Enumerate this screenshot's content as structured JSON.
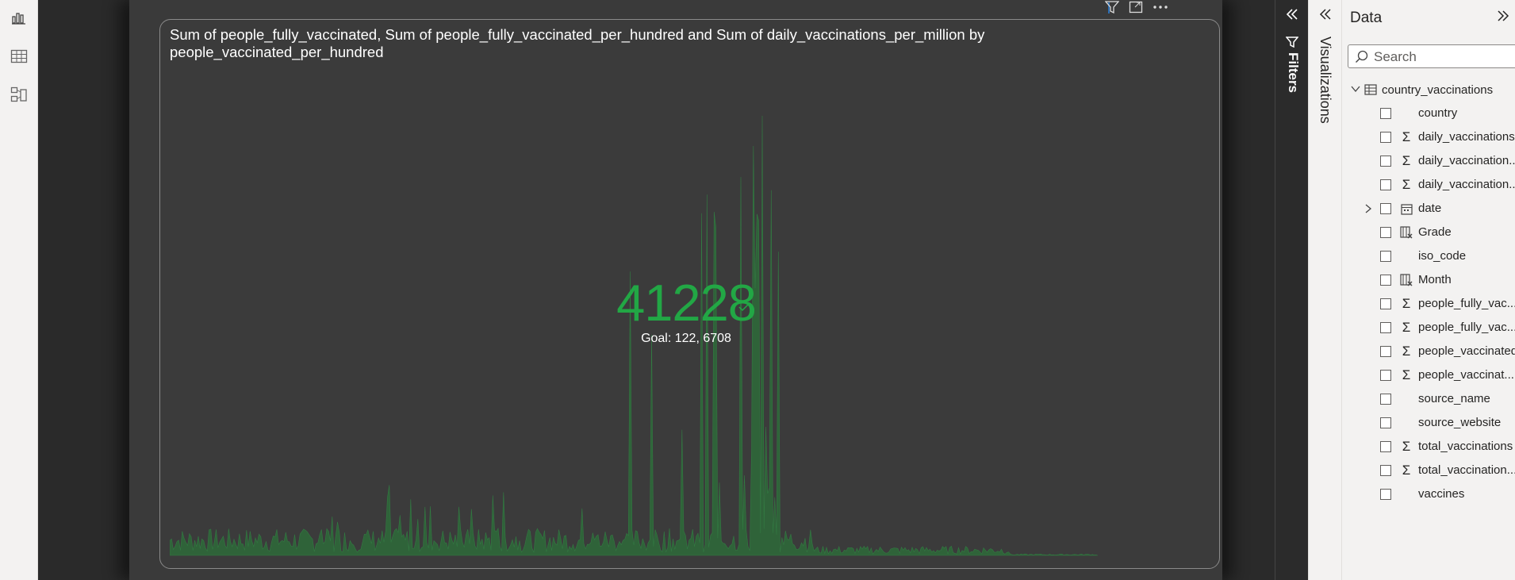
{
  "visual": {
    "title": "Sum of people_fully_vaccinated, Sum of people_fully_vaccinated_per_hundred and Sum of daily_vaccinations_per_million by people_vaccinated_per_hundred",
    "kpi_value": "41228",
    "kpi_goal": "Goal: 122, 6708",
    "accent_color": "#22a745",
    "area_color": "#2e6b3a"
  },
  "panes": {
    "filters_label": "Filters",
    "visualizations_label": "Visualizations",
    "data_title": "Data",
    "search_placeholder": "Search"
  },
  "table": {
    "name": "country_vaccinations"
  },
  "fields": [
    {
      "name": "country",
      "icon": "none"
    },
    {
      "name": "daily_vaccinations",
      "icon": "sigma"
    },
    {
      "name": "daily_vaccination...",
      "icon": "sigma"
    },
    {
      "name": "daily_vaccination...",
      "icon": "sigma"
    },
    {
      "name": "date",
      "icon": "calendar",
      "expandable": true
    },
    {
      "name": "Grade",
      "icon": "calc-column"
    },
    {
      "name": "iso_code",
      "icon": "none"
    },
    {
      "name": "Month",
      "icon": "calc-column"
    },
    {
      "name": "people_fully_vac...",
      "icon": "sigma"
    },
    {
      "name": "people_fully_vac...",
      "icon": "sigma"
    },
    {
      "name": "people_vaccinated",
      "icon": "sigma"
    },
    {
      "name": "people_vaccinat...",
      "icon": "sigma"
    },
    {
      "name": "source_name",
      "icon": "none"
    },
    {
      "name": "source_website",
      "icon": "none"
    },
    {
      "name": "total_vaccinations",
      "icon": "sigma"
    },
    {
      "name": "total_vaccination...",
      "icon": "sigma"
    },
    {
      "name": "vaccines",
      "icon": "none"
    }
  ]
}
